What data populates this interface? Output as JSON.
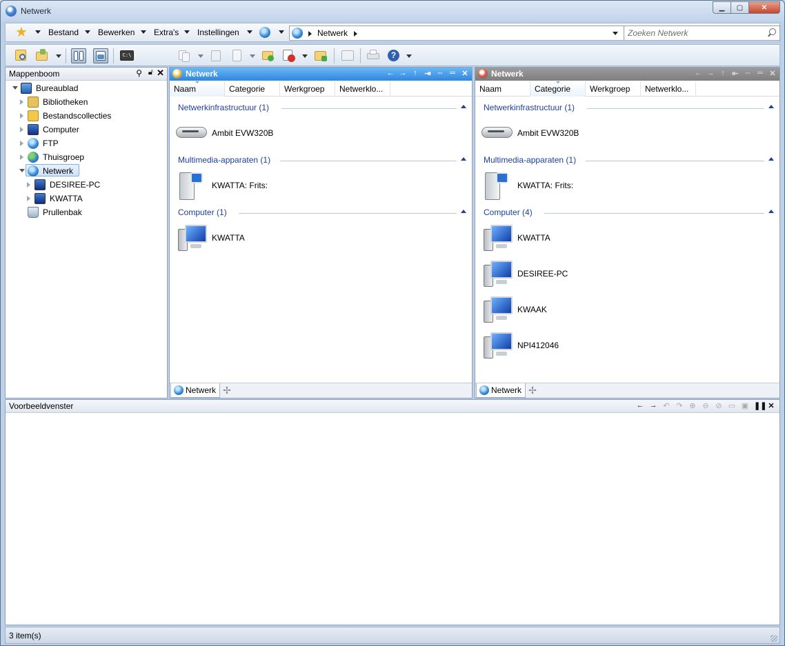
{
  "window": {
    "title": "Netwerk"
  },
  "menu": {
    "items": [
      "Bestand",
      "Bewerken",
      "Extra's",
      "Instellingen"
    ]
  },
  "address": {
    "path": "Netwerk"
  },
  "search": {
    "placeholder": "Zoeken Netwerk"
  },
  "tree": {
    "title": "Mappenboom",
    "items": [
      {
        "label": "Bureaublad",
        "icon": "desktop-icon"
      },
      {
        "label": "Bibliotheken",
        "icon": "libraries-icon"
      },
      {
        "label": "Bestandscollecties",
        "icon": "collections-icon"
      },
      {
        "label": "Computer",
        "icon": "computer-icon"
      },
      {
        "label": "FTP",
        "icon": "ftp-icon"
      },
      {
        "label": "Thuisgroep",
        "icon": "homegroup-icon"
      },
      {
        "label": "Netwerk",
        "icon": "network-icon"
      },
      {
        "label": "DESIREE-PC",
        "icon": "computer-icon"
      },
      {
        "label": "KWATTA",
        "icon": "computer-icon"
      },
      {
        "label": "Prullenbak",
        "icon": "recycle-bin-icon"
      }
    ]
  },
  "left_pane": {
    "title": "Netwerk",
    "columns": [
      "Naam",
      "Categorie",
      "Werkgroep",
      "Netwerklo..."
    ],
    "sorted_column": "Naam",
    "groups": [
      {
        "label": "Netwerkinfrastructuur (1)",
        "items": [
          "Ambit EVW320B"
        ]
      },
      {
        "label": "Multimedia-apparaten (1)",
        "items": [
          "KWATTA: Frits:"
        ]
      },
      {
        "label": "Computer (1)",
        "items": [
          "KWATTA"
        ]
      }
    ],
    "tab": "Netwerk"
  },
  "right_pane": {
    "title": "Netwerk",
    "columns": [
      "Naam",
      "Categorie",
      "Werkgroep",
      "Netwerklo..."
    ],
    "sorted_column": "Categorie",
    "groups": [
      {
        "label": "Netwerkinfrastructuur (1)",
        "items": [
          "Ambit EVW320B"
        ]
      },
      {
        "label": "Multimedia-apparaten (1)",
        "items": [
          "KWATTA: Frits:"
        ]
      },
      {
        "label": "Computer (4)",
        "items": [
          "KWATTA",
          "DESIREE-PC",
          "KWAAK",
          "NPI412046"
        ]
      }
    ],
    "tab": "Netwerk"
  },
  "preview": {
    "title": "Voorbeeldvenster"
  },
  "status": {
    "text": "3 item(s)"
  },
  "colors": {
    "active_title": "#2e86e0",
    "inactive_title": "#7e7e7e",
    "group_text": "#1e3f9a",
    "frame": "#bcd0e8"
  }
}
